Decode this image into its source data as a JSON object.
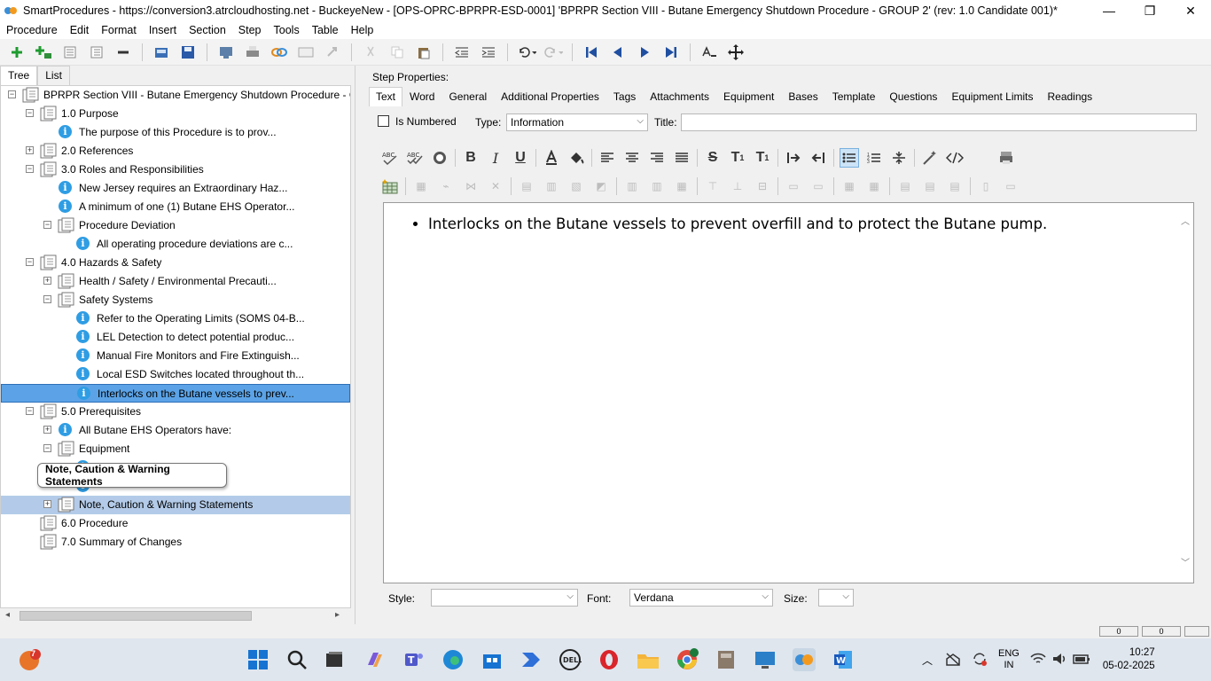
{
  "window": {
    "title": "SmartProcedures - https://conversion3.atrcloudhosting.net - BuckeyeNew - [OPS-OPRC-BPRPR-ESD-0001] 'BPRPR Section VIII - Butane Emergency Shutdown Procedure - GROUP 2' (rev: 1.0 Candidate 001)*",
    "minimize": "—",
    "maximize": "❐",
    "close": "✕"
  },
  "menu": [
    "Procedure",
    "Edit",
    "Format",
    "Insert",
    "Section",
    "Step",
    "Tools",
    "Table",
    "Help"
  ],
  "left_tabs": [
    "Tree",
    "List"
  ],
  "tree": [
    {
      "label": "BPRPR Section VIII - Butane Emergency Shutdown Procedure - G...",
      "icon": "page",
      "expander": "−",
      "level": 0
    },
    {
      "label": "1.0 Purpose",
      "icon": "page",
      "expander": "−",
      "level": 1
    },
    {
      "label": "The purpose of this Procedure is to prov...",
      "icon": "info",
      "expander": "",
      "level": 2
    },
    {
      "label": "2.0 References",
      "icon": "page",
      "expander": "+",
      "level": 1
    },
    {
      "label": "3.0 Roles and Responsibilities",
      "icon": "page",
      "expander": "−",
      "level": 1
    },
    {
      "label": "New Jersey requires an Extraordinary Haz...",
      "icon": "info",
      "expander": "",
      "level": 2
    },
    {
      "label": "A minimum of one (1) Butane EHS Operator...",
      "icon": "info",
      "expander": "",
      "level": 2
    },
    {
      "label": "Procedure Deviation",
      "icon": "page",
      "expander": "−",
      "level": 2
    },
    {
      "label": "All operating procedure deviations are c...",
      "icon": "info",
      "expander": "",
      "level": 3
    },
    {
      "label": "4.0 Hazards & Safety",
      "icon": "page",
      "expander": "−",
      "level": 1
    },
    {
      "label": "Health / Safety / Environmental Precauti...",
      "icon": "page",
      "expander": "+",
      "level": 2
    },
    {
      "label": "Safety Systems",
      "icon": "page",
      "expander": "−",
      "level": 2
    },
    {
      "label": "Refer to the Operating Limits (SOMS 04-B...",
      "icon": "info",
      "expander": "",
      "level": 3
    },
    {
      "label": "LEL Detection to detect potential produc...",
      "icon": "info",
      "expander": "",
      "level": 3
    },
    {
      "label": "Manual Fire Monitors and Fire Extinguish...",
      "icon": "info",
      "expander": "",
      "level": 3
    },
    {
      "label": "Local ESD Switches located throughout th...",
      "icon": "info",
      "expander": "",
      "level": 3
    },
    {
      "label": "Interlocks on the Butane vessels to prev...",
      "icon": "info",
      "expander": "",
      "level": 3,
      "state": "selected"
    },
    {
      "label": "5.0 Prerequisites",
      "icon": "page",
      "expander": "−",
      "level": 1
    },
    {
      "label": "All Butane EHS Operators have:",
      "icon": "info",
      "expander": "+",
      "level": 2
    },
    {
      "label": "Equipment",
      "icon": "page",
      "expander": "−",
      "level": 2
    },
    {
      "label": "",
      "icon": "info",
      "expander": "",
      "level": 3
    },
    {
      "label": "",
      "icon": "info",
      "expander": "",
      "level": 3
    },
    {
      "label": "Note, Caution & Warning Statements",
      "icon": "page",
      "expander": "+",
      "level": 2,
      "state": "highlight"
    },
    {
      "label": "6.0 Procedure",
      "icon": "page",
      "expander": "",
      "level": 1
    },
    {
      "label": "7.0 Summary of Changes",
      "icon": "page",
      "expander": "",
      "level": 1
    }
  ],
  "tooltip": "Note, Caution & Warning Statements",
  "step_properties": {
    "label": "Step Properties:",
    "tabs": [
      "Text",
      "Word",
      "General",
      "Additional Properties",
      "Tags",
      "Attachments",
      "Equipment",
      "Bases",
      "Template",
      "Questions",
      "Equipment Limits",
      "Readings"
    ],
    "is_numbered_label": "Is Numbered",
    "type_label": "Type:",
    "type_value": "Information",
    "title_label": "Title:",
    "title_value": ""
  },
  "editor": {
    "bullet_text": "Interlocks on the Butane vessels to prevent overfill and to protect the Butane pump."
  },
  "bottom": {
    "style_label": "Style:",
    "style_value": "",
    "font_label": "Font:",
    "font_value": "Verdana",
    "size_label": "Size:",
    "size_value": ""
  },
  "status": {
    "box1": "0",
    "box2": "0"
  },
  "taskbar": {
    "badge": "7",
    "lang": "ENG",
    "region": "IN",
    "time": "10:27",
    "date": "05-02-2025"
  }
}
